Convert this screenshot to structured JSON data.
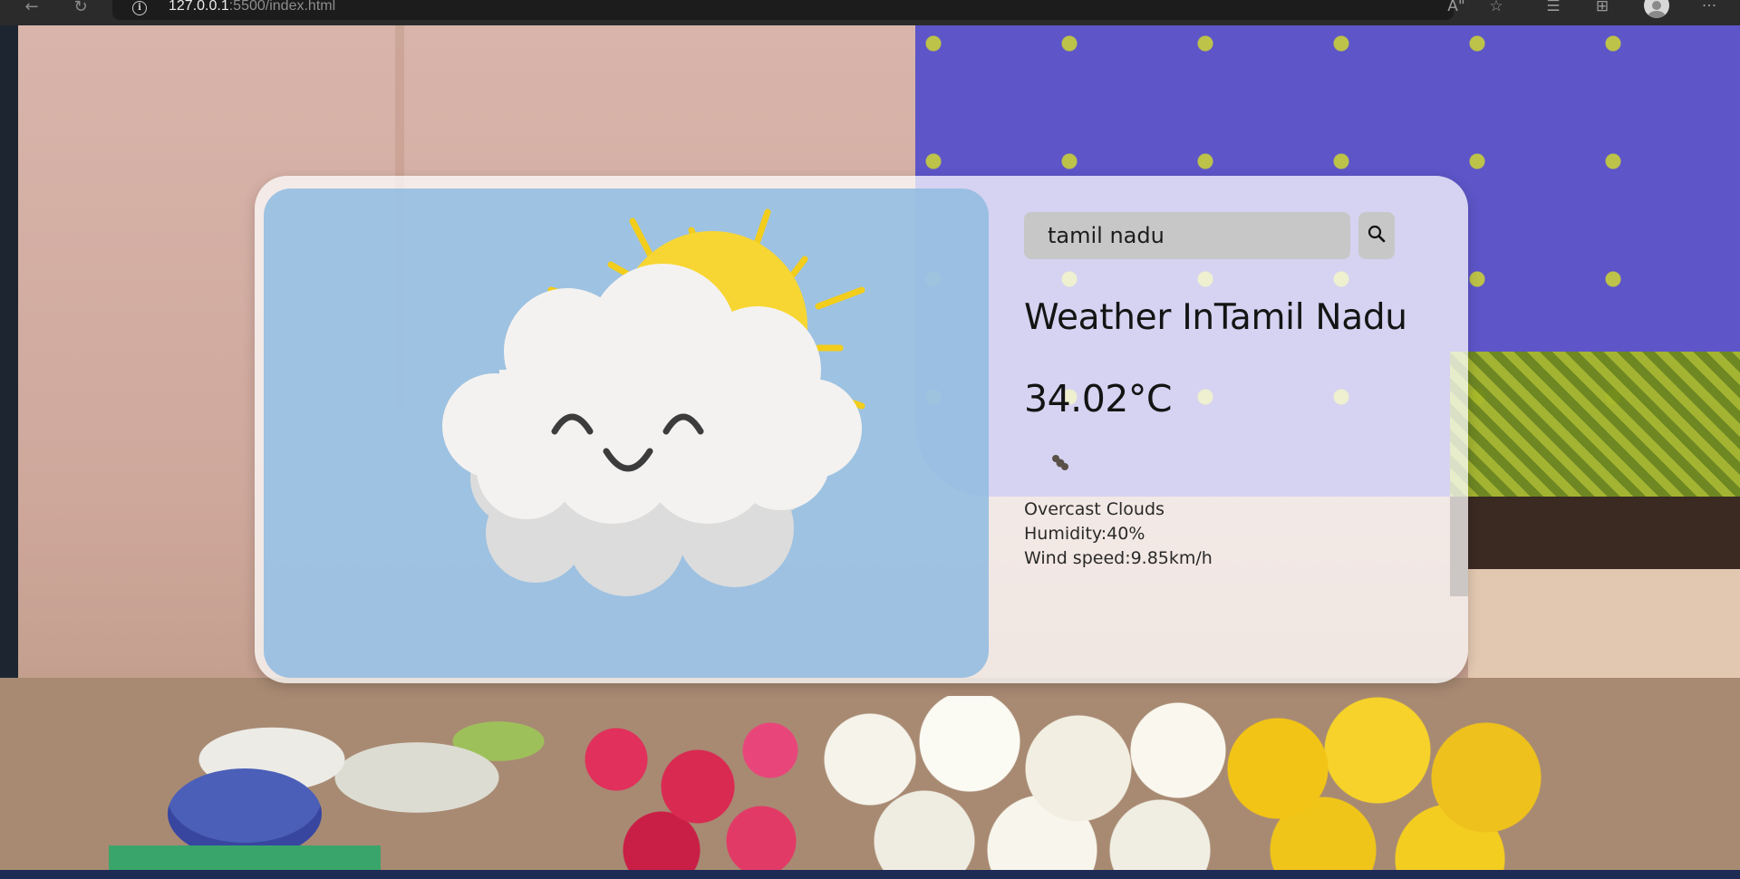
{
  "browser": {
    "url_host": "127.0.0.1",
    "url_rest": ":5500/index.html",
    "reader_icon": "read-aloud-icon",
    "ai_icon": "Aᵃ"
  },
  "weather": {
    "search_value": "tamil nadu",
    "heading": "Weather InTamil Nadu",
    "temperature": "34.02°C",
    "description": "Overcast Clouds",
    "humidity": "Humidity:40%",
    "wind": "Wind speed:9.85km/h",
    "icon": "overcast-clouds-icon"
  },
  "colors": {
    "card_bg": "#ffffff",
    "illustration_bg": "#92bce0",
    "sun": "#f7d633",
    "cloud": "#f4f2f0",
    "input_bg": "#c7c7c7"
  }
}
